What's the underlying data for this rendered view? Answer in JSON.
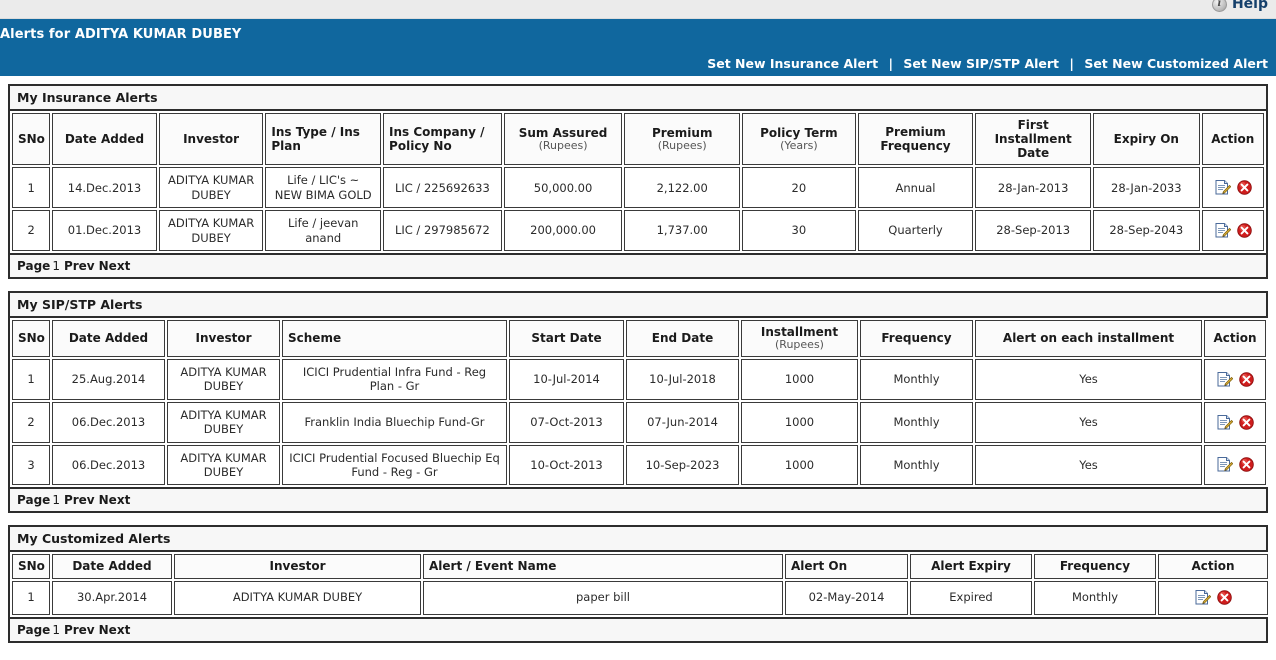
{
  "topbar": {
    "help_label": "Help",
    "info_icon": "info-icon"
  },
  "banner": {
    "title": "Alerts for ADITYA KUMAR DUBEY",
    "links": [
      {
        "label": "Set New Insurance Alert"
      },
      {
        "label": "Set New SIP/STP Alert"
      },
      {
        "label": "Set New Customized Alert"
      }
    ],
    "separator": "|",
    "color": "#10679e"
  },
  "pagination": {
    "page_label": "Page",
    "page_number": "1",
    "prev_label": "Prev",
    "next_label": "Next"
  },
  "icons": {
    "edit": "edit-icon",
    "delete": "delete-icon"
  },
  "insurance": {
    "title": "My Insurance Alerts",
    "columns": [
      {
        "label": "SNo",
        "unit": ""
      },
      {
        "label": "Date Added",
        "unit": ""
      },
      {
        "label": "Investor",
        "unit": ""
      },
      {
        "label": "Ins Type / Ins Plan",
        "unit": ""
      },
      {
        "label": "Ins Company / Policy No",
        "unit": ""
      },
      {
        "label": "Sum Assured",
        "unit": "(Rupees)"
      },
      {
        "label": "Premium",
        "unit": "(Rupees)"
      },
      {
        "label": "Policy Term",
        "unit": "(Years)"
      },
      {
        "label": "Premium Frequency",
        "unit": ""
      },
      {
        "label": "First Installment Date",
        "unit": ""
      },
      {
        "label": "Expiry On",
        "unit": ""
      },
      {
        "label": "Action",
        "unit": ""
      }
    ],
    "rows": [
      {
        "sno": "1",
        "date_added": "14.Dec.2013",
        "investor": "ADITYA KUMAR DUBEY",
        "ins_type_plan": "Life  / LIC's ~ NEW BIMA GOLD",
        "ins_company_policy": "LIC / 225692633",
        "sum_assured": "50,000.00",
        "premium": "2,122.00",
        "policy_term": "20",
        "premium_frequency": "Annual",
        "first_installment_date": "28-Jan-2013",
        "expiry_on": "28-Jan-2033"
      },
      {
        "sno": "2",
        "date_added": "01.Dec.2013",
        "investor": "ADITYA KUMAR DUBEY",
        "ins_type_plan": "Life  / jeevan anand",
        "ins_company_policy": "LIC / 297985672",
        "sum_assured": "200,000.00",
        "premium": "1,737.00",
        "policy_term": "30",
        "premium_frequency": "Quarterly",
        "first_installment_date": "28-Sep-2013",
        "expiry_on": "28-Sep-2043"
      }
    ]
  },
  "sipstp": {
    "title": "My SIP/STP Alerts",
    "columns": [
      {
        "label": "SNo",
        "unit": ""
      },
      {
        "label": "Date Added",
        "unit": ""
      },
      {
        "label": "Investor",
        "unit": ""
      },
      {
        "label": "Scheme",
        "unit": ""
      },
      {
        "label": "Start Date",
        "unit": ""
      },
      {
        "label": "End Date",
        "unit": ""
      },
      {
        "label": "Installment",
        "unit": "(Rupees)"
      },
      {
        "label": "Frequency",
        "unit": ""
      },
      {
        "label": "Alert on each installment",
        "unit": ""
      },
      {
        "label": "Action",
        "unit": ""
      }
    ],
    "rows": [
      {
        "sno": "1",
        "date_added": "25.Aug.2014",
        "investor": "ADITYA KUMAR DUBEY",
        "scheme": "ICICI Prudential Infra Fund - Reg Plan - Gr",
        "start_date": "10-Jul-2014",
        "end_date": "10-Jul-2018",
        "installment": "1000",
        "frequency": "Monthly",
        "alert_each": "Yes"
      },
      {
        "sno": "2",
        "date_added": "06.Dec.2013",
        "investor": "ADITYA KUMAR DUBEY",
        "scheme": "Franklin India Bluechip Fund-Gr",
        "start_date": "07-Oct-2013",
        "end_date": "07-Jun-2014",
        "installment": "1000",
        "frequency": "Monthly",
        "alert_each": "Yes"
      },
      {
        "sno": "3",
        "date_added": "06.Dec.2013",
        "investor": "ADITYA KUMAR DUBEY",
        "scheme": "ICICI Prudential Focused Bluechip Eq Fund - Reg - Gr",
        "start_date": "10-Oct-2013",
        "end_date": "10-Sep-2023",
        "installment": "1000",
        "frequency": "Monthly",
        "alert_each": "Yes"
      }
    ]
  },
  "customized": {
    "title": "My Customized Alerts",
    "columns": [
      {
        "label": "SNo",
        "unit": ""
      },
      {
        "label": "Date Added",
        "unit": ""
      },
      {
        "label": "Investor",
        "unit": ""
      },
      {
        "label": "Alert / Event Name",
        "unit": ""
      },
      {
        "label": "Alert On",
        "unit": ""
      },
      {
        "label": "Alert Expiry",
        "unit": ""
      },
      {
        "label": "Frequency",
        "unit": ""
      },
      {
        "label": "Action",
        "unit": ""
      }
    ],
    "rows": [
      {
        "sno": "1",
        "date_added": "30.Apr.2014",
        "investor": "ADITYA KUMAR DUBEY",
        "event_name": "paper bill",
        "alert_on": "02-May-2014",
        "alert_expiry": "Expired",
        "alert_expiry_color": "#e01b1b",
        "frequency": "Monthly"
      }
    ]
  }
}
